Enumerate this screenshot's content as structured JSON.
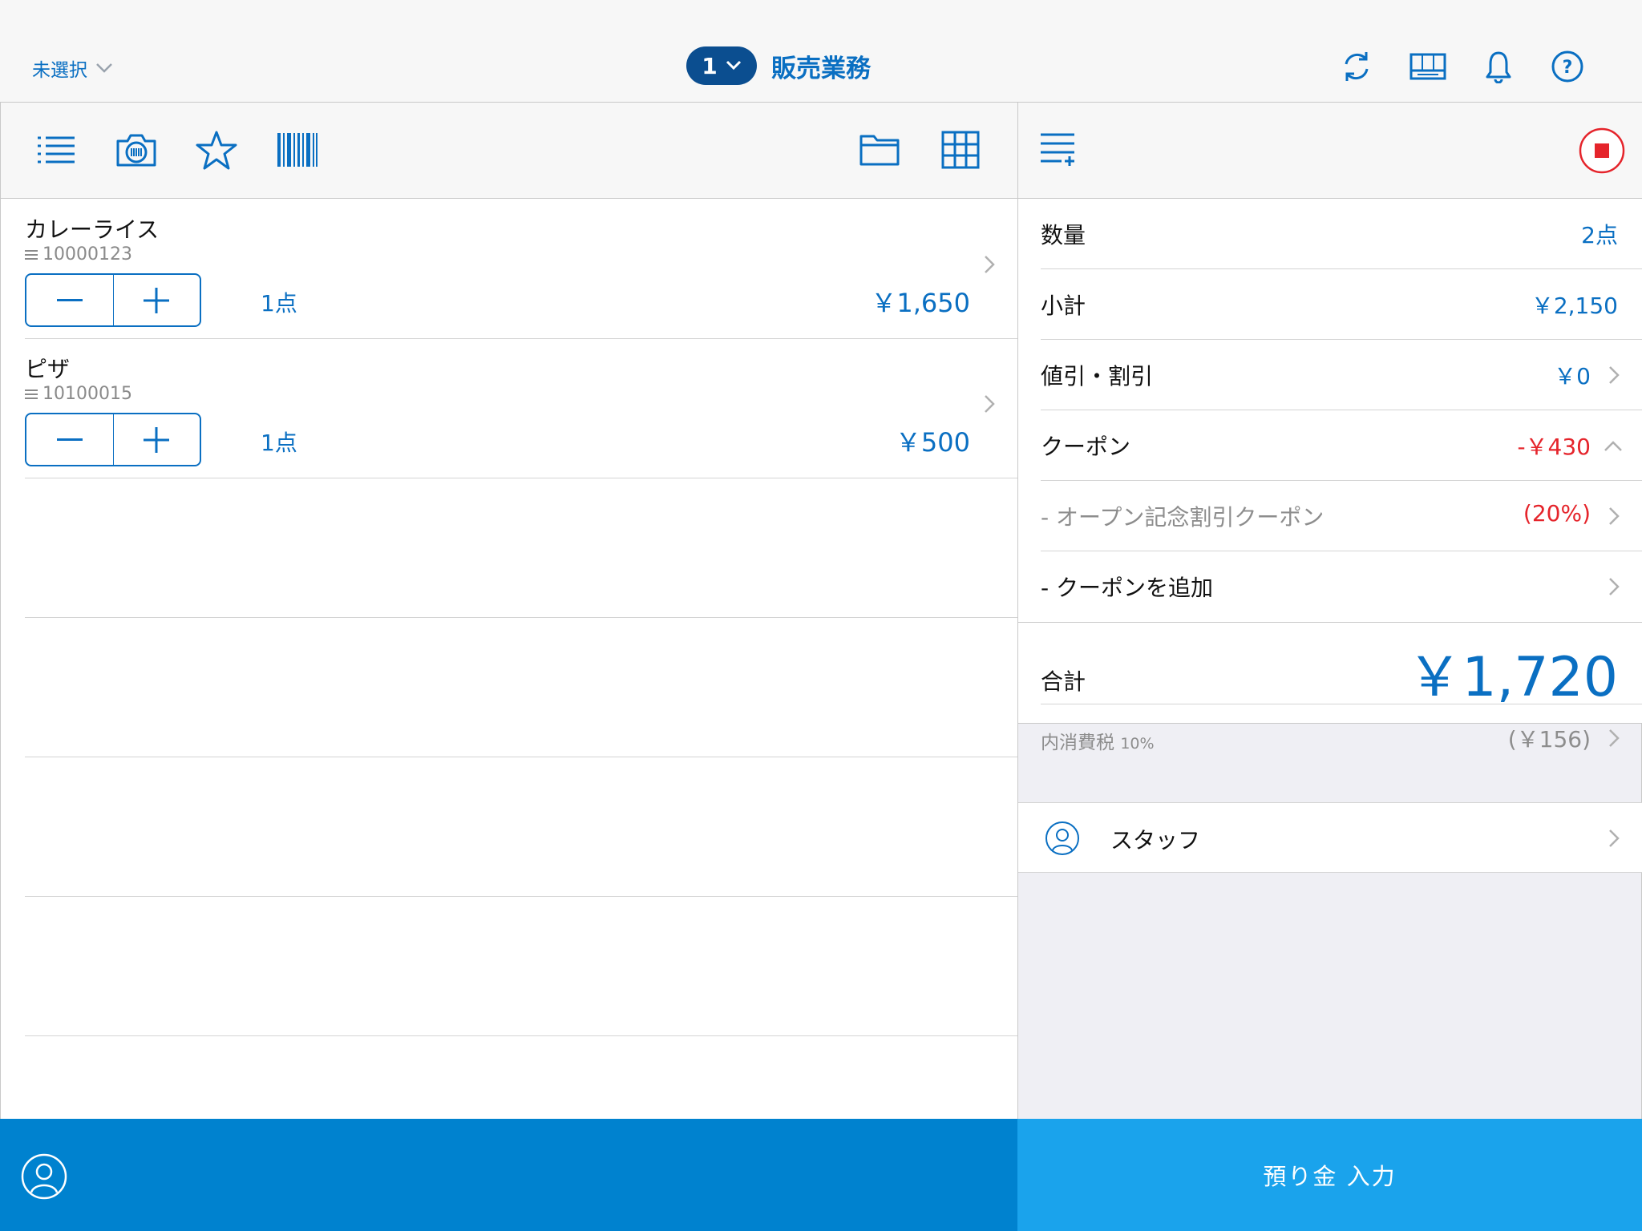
{
  "header": {
    "store_label": "未選択",
    "register_number": "1",
    "mode_title": "販売業務",
    "icons": [
      "refresh-icon",
      "drawer-icon",
      "bell-icon",
      "help-icon"
    ]
  },
  "left_toolbar": {
    "icons": [
      "list-icon",
      "camera-scan-icon",
      "star-icon",
      "barcode-icon",
      "folder-icon",
      "grid-icon"
    ]
  },
  "items": [
    {
      "name": "カレーライス",
      "code": "10000123",
      "qty": "1点",
      "price": "￥1,650"
    },
    {
      "name": "ピザ",
      "code": "10100015",
      "qty": "1点",
      "price": "￥500"
    }
  ],
  "summary": {
    "quantity": {
      "label": "数量",
      "value": "2点"
    },
    "subtotal": {
      "label": "小計",
      "value": "￥2,150"
    },
    "discount": {
      "label": "値引・割引",
      "value": "￥0"
    },
    "coupon": {
      "label": "クーポン",
      "value": "-￥430"
    },
    "coupon_item": {
      "label": "- オープン記念割引クーポン",
      "value": "(20%)"
    },
    "coupon_add": {
      "label": "- クーポンを追加"
    },
    "total": {
      "label": "合計",
      "value": "￥1,720"
    },
    "tax": {
      "label": "内消費税",
      "rate": "10%",
      "value": "(￥156)"
    }
  },
  "staff": {
    "label": "スタッフ"
  },
  "footer": {
    "deposit_label": "預り金 入力"
  },
  "colors": {
    "accent": "#0a6fc2",
    "register_pill": "#0b4e90",
    "footer_left": "#0082cf",
    "footer_right": "#1aa3ec",
    "negative": "#e5242b"
  }
}
